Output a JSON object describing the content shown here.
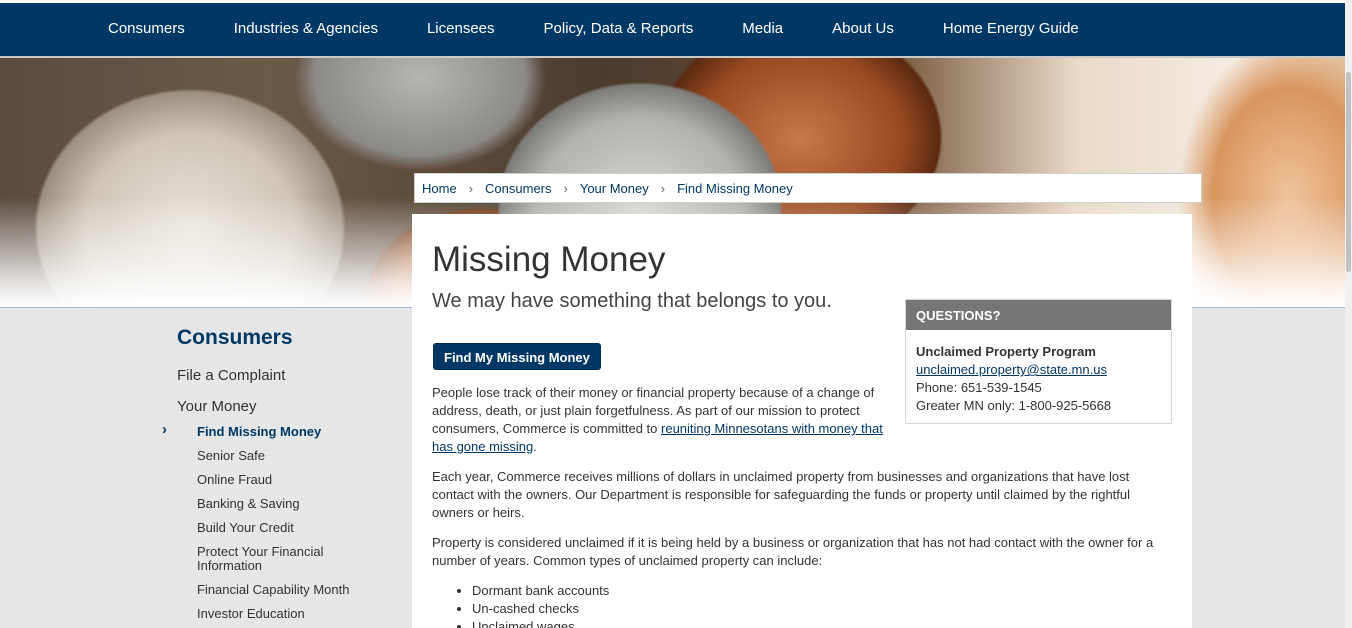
{
  "topnav": {
    "items": [
      "Consumers",
      "Industries & Agencies",
      "Licensees",
      "Policy, Data & Reports",
      "Media",
      "About Us",
      "Home Energy Guide"
    ]
  },
  "breadcrumb": {
    "items": [
      "Home",
      "Consumers",
      "Your Money",
      "Find Missing Money"
    ],
    "separator": "›"
  },
  "main": {
    "title": "Missing Money",
    "subtitle": "We may have something that belongs to you.",
    "cta_label": "Find My Missing Money",
    "p1_text": "People lose track of their money or financial property because of a change of address, death, or just plain forgetfulness. As part of our mission to protect consumers, Commerce is committed to ",
    "p1_link": "reuniting Minnesotans with money that has gone missing",
    "p1_end": ".",
    "p2": "Each year, Commerce receives millions of dollars in unclaimed property from businesses and organizations that have lost contact with the owners. Our Department is responsible for safeguarding the funds or property until claimed by the rightful owners or heirs.",
    "p3": "Property is considered unclaimed if it is being held by a business or organization that has not had contact with the owner for a number of years. Common types of unclaimed property can include:",
    "bullets": [
      "Dormant bank accounts",
      "Un-cashed checks",
      "Unclaimed wages"
    ]
  },
  "questions": {
    "heading": "QUESTIONS?",
    "program": "Unclaimed Property Program",
    "email": "unclaimed.property@state.mn.us",
    "phone": "Phone: 651-539-1545",
    "greater": "Greater MN only: 1-800-925-5668"
  },
  "sidenav": {
    "heading": "Consumers",
    "level1": [
      "File a Complaint",
      "Your Money"
    ],
    "active_marker": "›",
    "level2": [
      "Find Missing Money",
      "Senior Safe",
      "Online Fraud",
      "Banking & Saving",
      "Build Your Credit",
      "Protect Your Financial Information",
      "Financial Capability Month",
      "Investor Education"
    ]
  },
  "colors": {
    "nav_bg": "#003865",
    "accent": "#003865",
    "questions_header": "#767676"
  }
}
